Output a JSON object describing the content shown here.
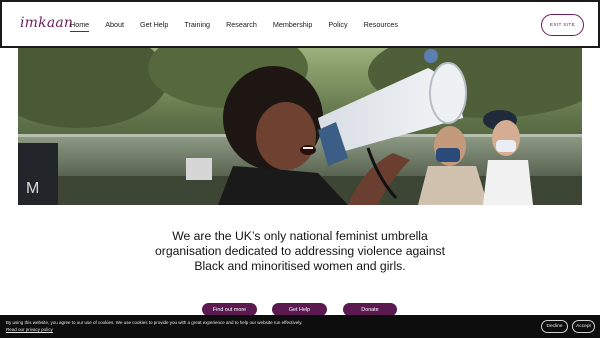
{
  "header": {
    "logo": "imkaan",
    "nav": [
      {
        "label": "Home",
        "active": true
      },
      {
        "label": "About",
        "active": false
      },
      {
        "label": "Get Help",
        "active": false
      },
      {
        "label": "Training",
        "active": false
      },
      {
        "label": "Research",
        "active": false
      },
      {
        "label": "Membership",
        "active": false
      },
      {
        "label": "Policy",
        "active": false
      },
      {
        "label": "Resources",
        "active": false
      }
    ],
    "exit_label": "EXIT SITE"
  },
  "hero": {
    "icon": "megaphone-protest-photo"
  },
  "mission": {
    "text": "We are the UK’s only national feminist umbrella organisation dedicated to addressing violence against Black and minoritised women and girls."
  },
  "cta": {
    "find_out_more": "Find out more",
    "get_help": "Get Help",
    "donate": "Donate"
  },
  "cookie": {
    "text": "By using this website, you agree to our use of cookies. We use cookies to provide you with a great experience and to help our website run effectively.",
    "link": "Read our privacy policy",
    "decline": "Decline",
    "accept": "Accept"
  },
  "colors": {
    "brand": "#6b1f5c",
    "button": "#5a1a4f",
    "cookie_bg": "#0d0d0d"
  }
}
